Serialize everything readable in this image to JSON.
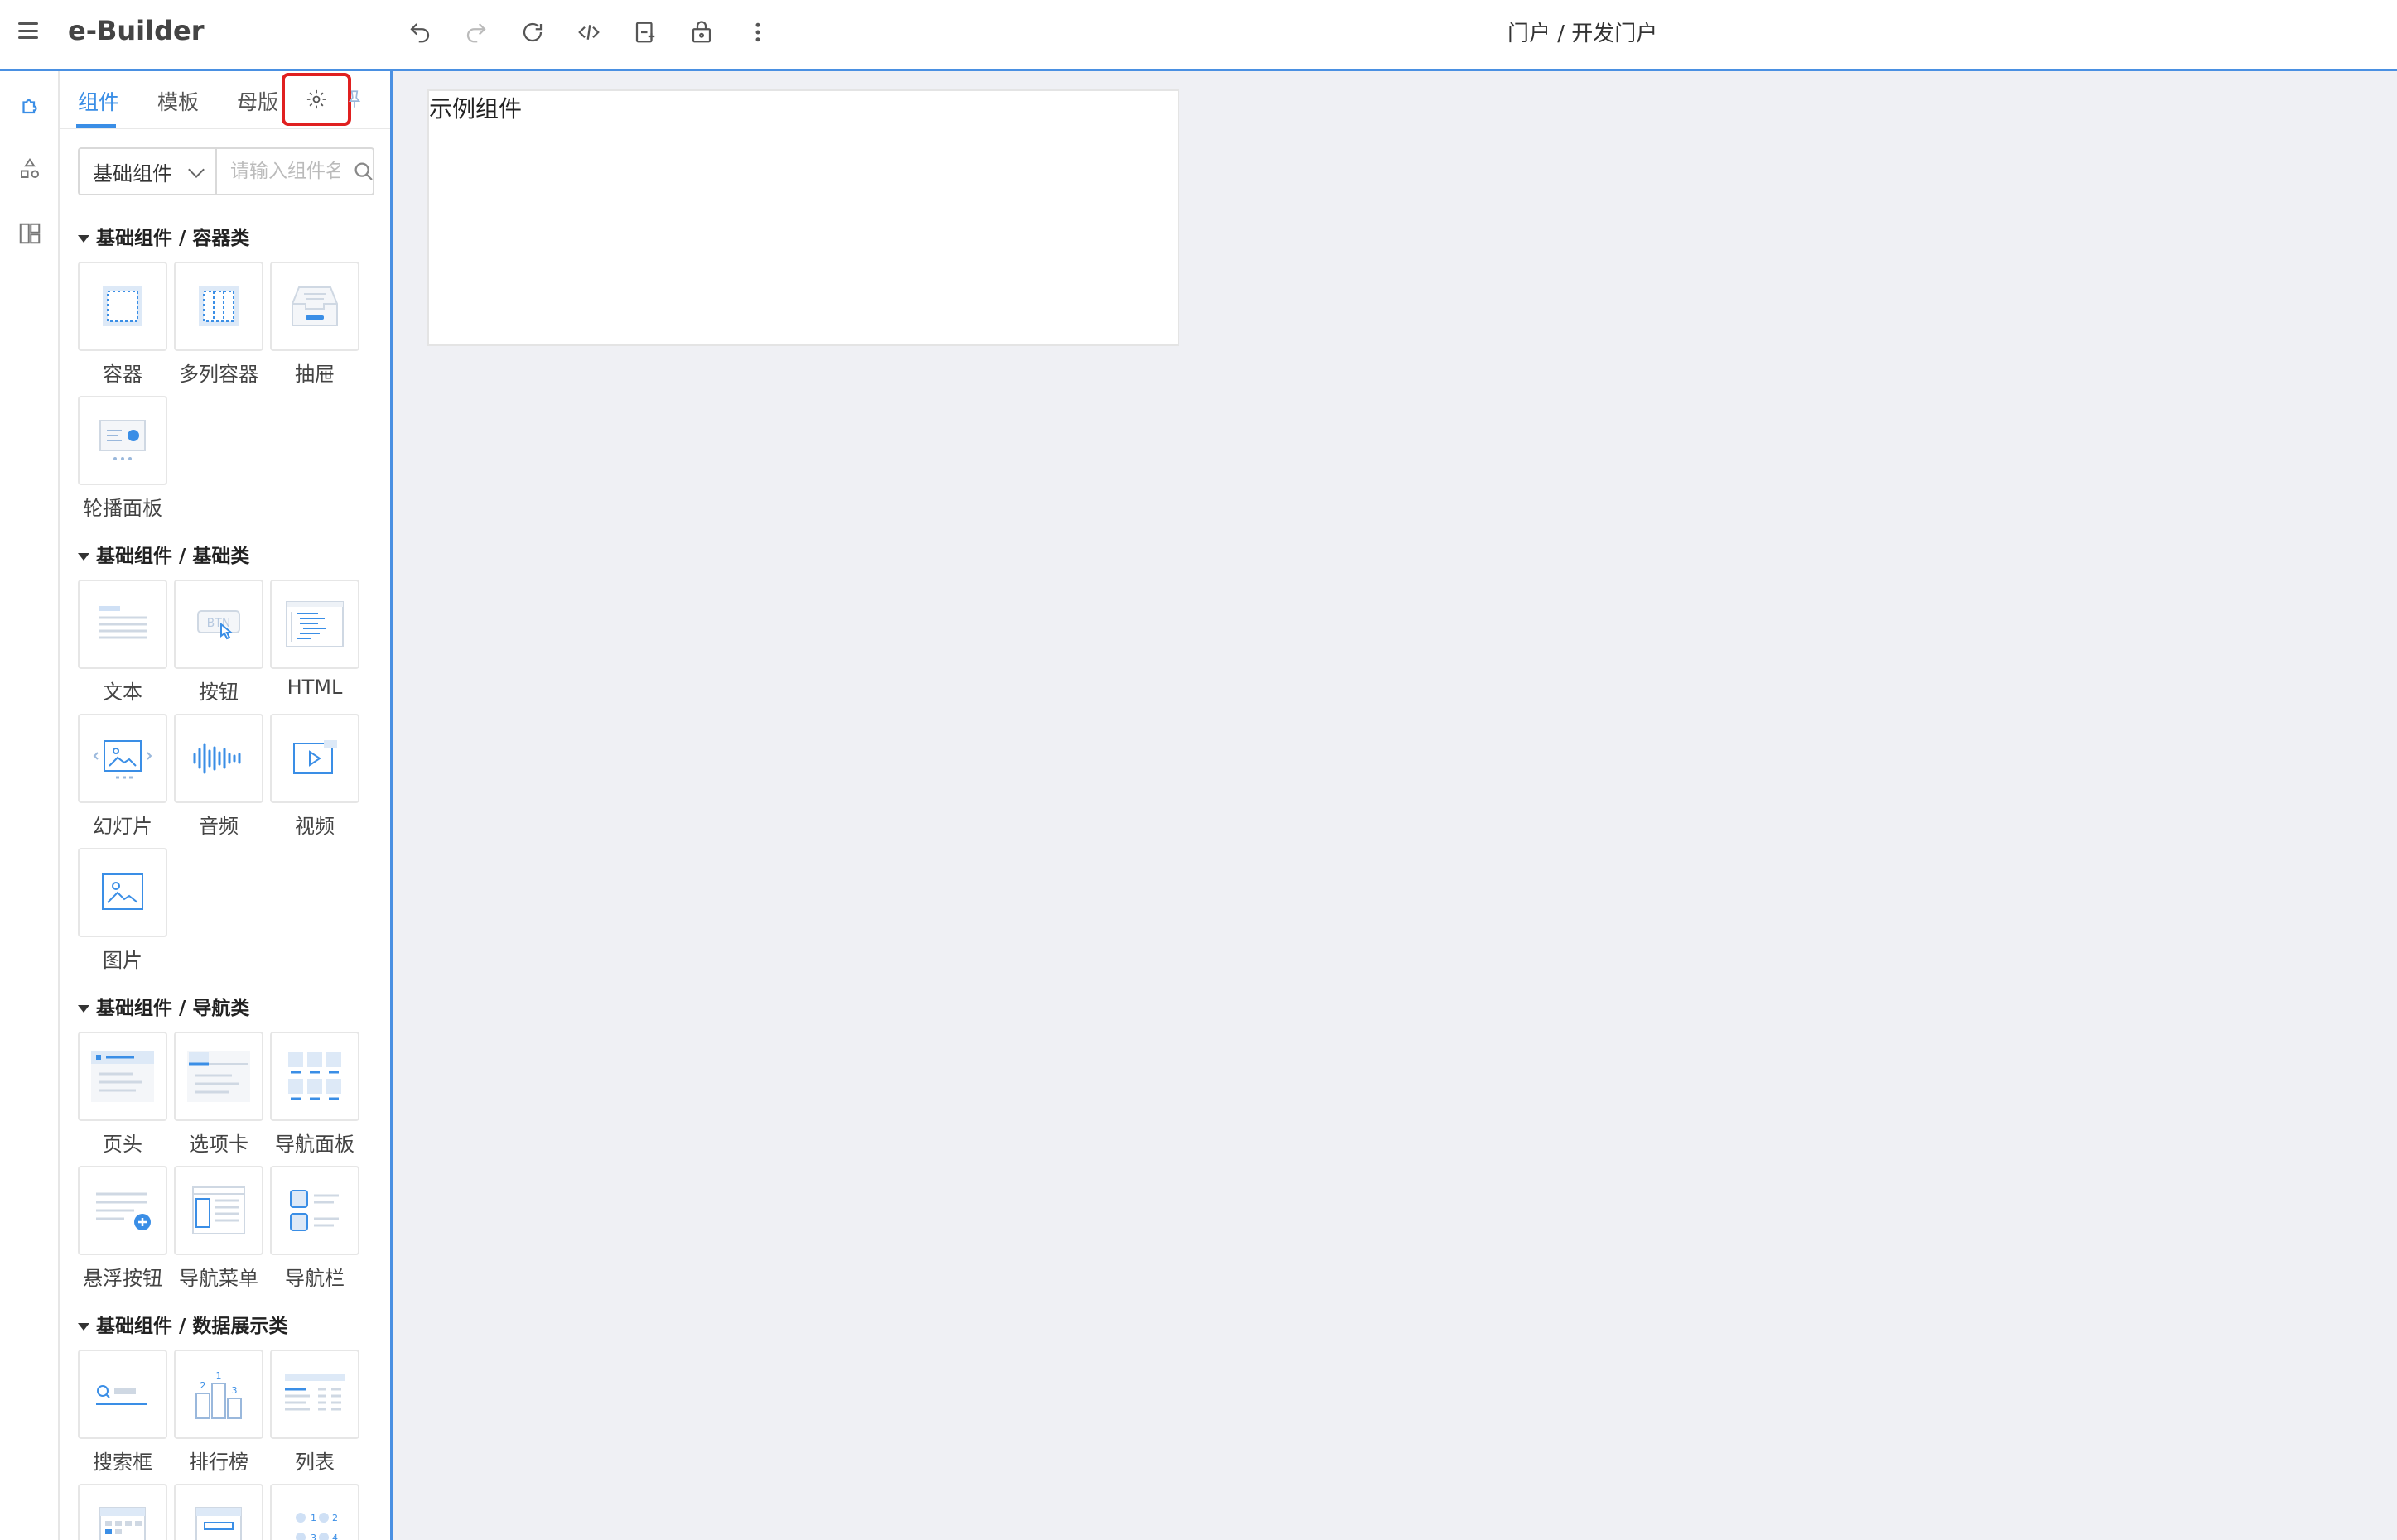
{
  "header": {
    "app_title": "e-Builder",
    "breadcrumb": "门户 / 开发门户",
    "tools": [
      "undo-icon",
      "redo-icon",
      "refresh-icon",
      "code-icon",
      "add-page-icon",
      "lock-icon",
      "more-icon"
    ]
  },
  "rail": {
    "items": [
      "puzzle-icon",
      "shapes-icon",
      "layout-icon"
    ]
  },
  "panel": {
    "tabs": [
      {
        "label": "组件",
        "active": true
      },
      {
        "label": "模板",
        "active": false
      },
      {
        "label": "母版",
        "active": false
      }
    ],
    "settings_icon": "gear-icon",
    "pin_icon": "pin-icon",
    "filter": {
      "selected": "基础组件",
      "search_placeholder": "请输入组件名"
    },
    "sections": [
      {
        "title": "基础组件 / 容器类",
        "items": [
          "容器",
          "多列容器",
          "抽屉",
          "轮播面板"
        ]
      },
      {
        "title": "基础组件 / 基础类",
        "items": [
          "文本",
          "按钮",
          "HTML",
          "幻灯片",
          "音频",
          "视频",
          "图片"
        ]
      },
      {
        "title": "基础组件 / 导航类",
        "items": [
          "页头",
          "选项卡",
          "导航面板",
          "悬浮按钮",
          "导航菜单",
          "导航栏"
        ]
      },
      {
        "title": "基础组件 / 数据展示类",
        "items": [
          "搜索框",
          "排行榜",
          "列表"
        ]
      }
    ]
  },
  "canvas": {
    "sample_component_text": "示例组件"
  },
  "colors": {
    "accent": "#3a8ee6",
    "highlight": "#e02020",
    "canvas_bg": "#eff0f4"
  }
}
